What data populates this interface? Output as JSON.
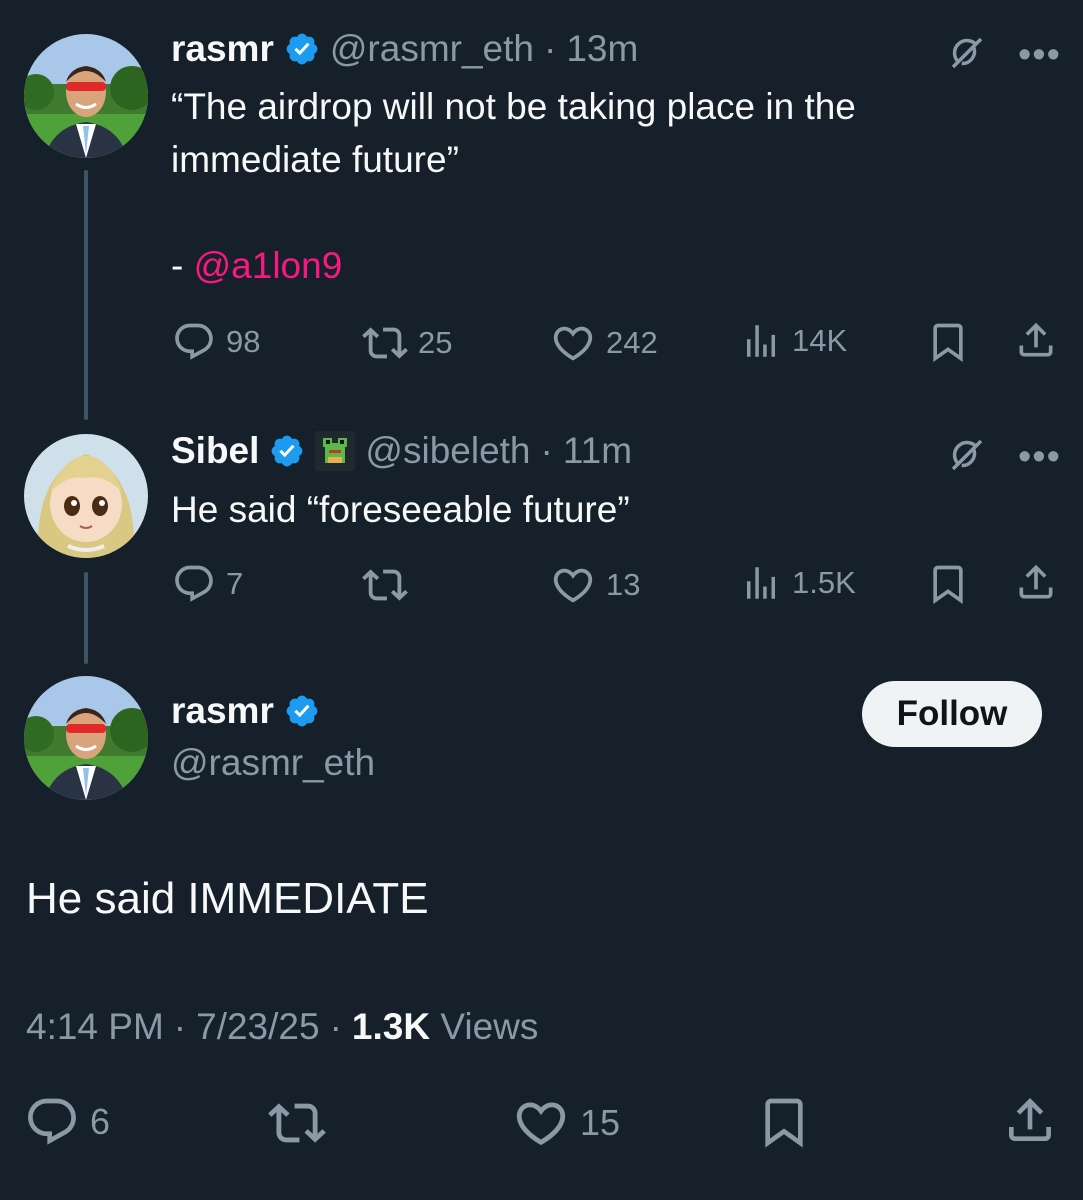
{
  "tweets": [
    {
      "name": "rasmr",
      "handle": "@rasmr_eth",
      "time": "13m",
      "text_line1": "“The airdrop will not be taking place in the",
      "text_line2": "immediate future”",
      "text_prefix": "- ",
      "mention": "@a1lon9",
      "replies": "98",
      "retweets": "25",
      "likes": "242",
      "views": "14K"
    },
    {
      "name": "Sibel",
      "handle": "@sibeleth",
      "time": "11m",
      "text": "He said “foreseeable future”",
      "replies": "7",
      "retweets": "",
      "likes": "13",
      "views": "1.5K"
    }
  ],
  "main": {
    "name": "rasmr",
    "handle": "@rasmr_eth",
    "follow_label": "Follow",
    "text": "He said IMMEDIATE",
    "time": "4:14 PM",
    "date": "7/23/25",
    "views_count": "1.3K",
    "views_label": "Views",
    "replies": "6",
    "likes": "15"
  },
  "separator": "·",
  "colors": {
    "background": "#15202b",
    "text": "#f7f9f9",
    "secondary": "#8b98a5",
    "verified": "#1d9bf0",
    "mention": "#f91880"
  },
  "icons": [
    "verified-badge-icon",
    "frog-emoji-icon",
    "grok-icon",
    "more-icon",
    "reply-icon",
    "retweet-icon",
    "like-icon",
    "views-icon",
    "bookmark-icon",
    "share-icon"
  ]
}
